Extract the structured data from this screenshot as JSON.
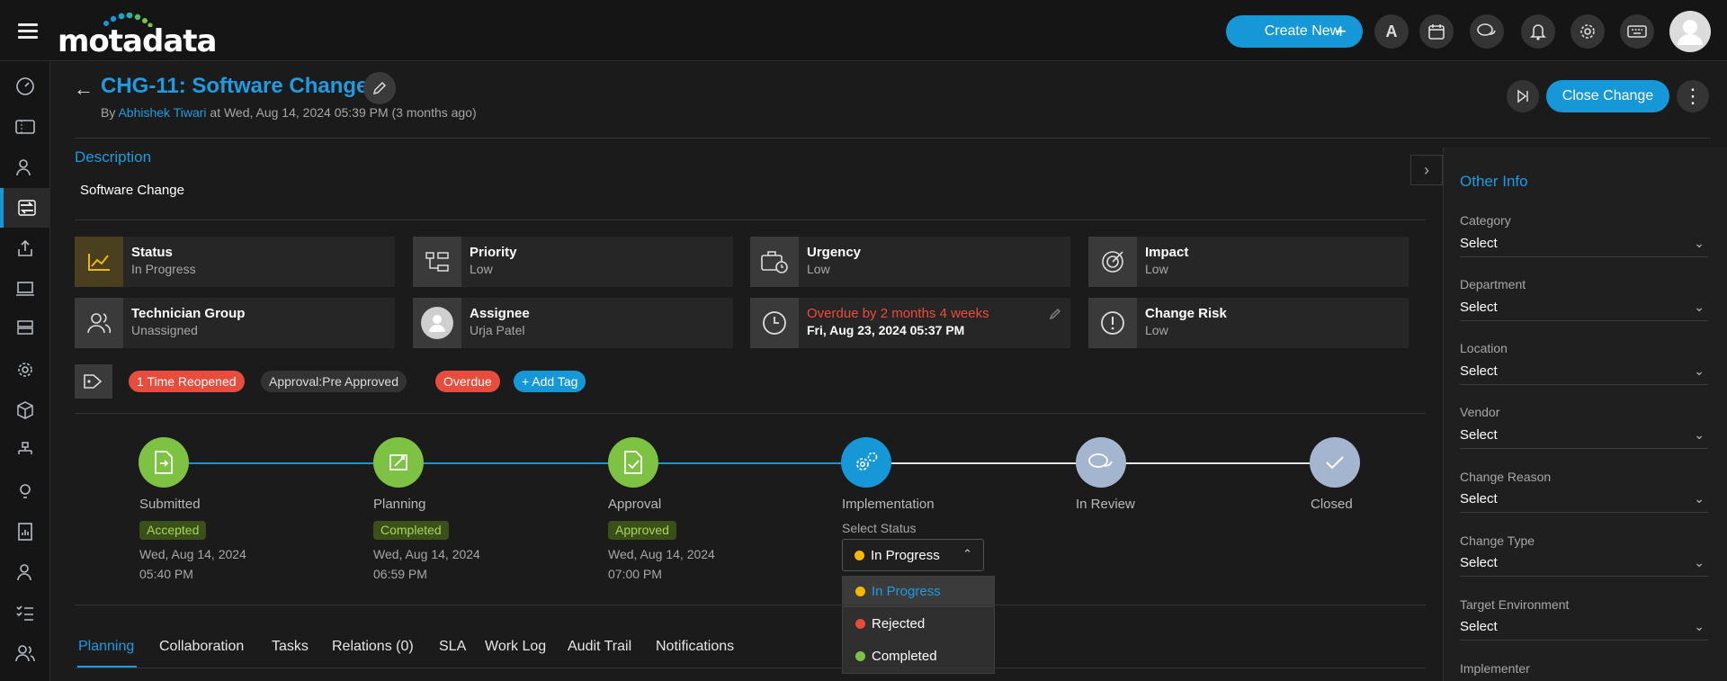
{
  "header": {
    "logo": "motadata",
    "create_new": "Create New",
    "user_initial": "A"
  },
  "request": {
    "title": "CHG-11: Software Change",
    "by_prefix": "By",
    "author": "Abhishek Tiwari",
    "created_text": "at Wed, Aug 14, 2024 05:39 PM (3 months ago)",
    "close_button": "Close Change"
  },
  "description": {
    "heading": "Description",
    "text": "Software Change"
  },
  "cards": [
    {
      "label": "Status",
      "value": "In Progress"
    },
    {
      "label": "Priority",
      "value": "Low"
    },
    {
      "label": "Urgency",
      "value": "Low"
    },
    {
      "label": "Impact",
      "value": "Low"
    },
    {
      "label": "Technician Group",
      "value": "Unassigned"
    },
    {
      "label": "Assignee",
      "value": "Urja Patel"
    },
    {
      "label": "Overdue by 2 months 4 weeks",
      "value": "Fri, Aug 23, 2024 05:37 PM"
    },
    {
      "label": "Change Risk",
      "value": "Low"
    }
  ],
  "tags": [
    "1 Time Reopened",
    "Approval:Pre Approved",
    "Overdue",
    "Add Tag"
  ],
  "stages": [
    {
      "name": "Submitted",
      "badge": "Accepted",
      "date": "Wed, Aug 14, 2024",
      "time": "05:40 PM"
    },
    {
      "name": "Planning",
      "badge": "Completed",
      "date": "Wed, Aug 14, 2024",
      "time": "06:59 PM"
    },
    {
      "name": "Approval",
      "badge": "Approved",
      "date": "Wed, Aug 14, 2024",
      "time": "07:00 PM"
    },
    {
      "name": "Implementation",
      "select_label": "Select Status",
      "selected": "In Progress"
    },
    {
      "name": "In Review"
    },
    {
      "name": "Closed"
    }
  ],
  "status_options": [
    {
      "label": "In Progress",
      "color": "#f5b800"
    },
    {
      "label": "Rejected",
      "color": "#e74c3c"
    },
    {
      "label": "Completed",
      "color": "#7dc242"
    }
  ],
  "tabs": [
    "Planning",
    "Collaboration",
    "Tasks",
    "Relations (0)",
    "SLA",
    "Work Log",
    "Audit Trail",
    "Notifications"
  ],
  "other_info": {
    "title": "Other Info",
    "fields": [
      {
        "label": "Category",
        "value": "Select"
      },
      {
        "label": "Department",
        "value": "Select"
      },
      {
        "label": "Location",
        "value": "Select"
      },
      {
        "label": "Vendor",
        "value": "Select"
      },
      {
        "label": "Change Reason",
        "value": "Select"
      },
      {
        "label": "Change Type",
        "value": "Select"
      },
      {
        "label": "Target Environment",
        "value": "Select"
      },
      {
        "label": "Implementer",
        "value": ""
      }
    ]
  },
  "colors": {
    "accent": "#1697d7",
    "stage_done": "#7dc242",
    "stage_current": "#1697d7",
    "stage_pending": "#a4b6cf"
  }
}
